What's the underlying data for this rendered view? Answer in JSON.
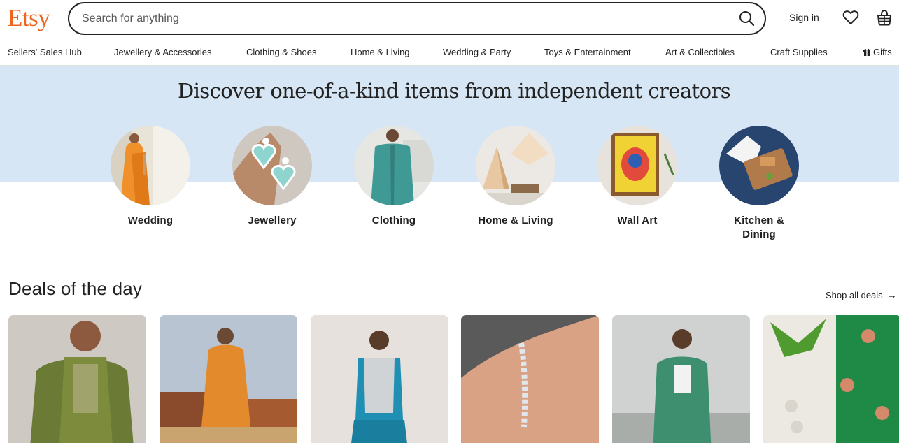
{
  "header": {
    "logo": "Etsy",
    "search_placeholder": "Search for anything",
    "sign_in": "Sign in",
    "icons": {
      "search": "search-icon",
      "favorites": "heart-icon",
      "cart": "basket-icon"
    }
  },
  "nav": {
    "items": [
      "Sellers' Sales Hub",
      "Jewellery & Accessories",
      "Clothing & Shoes",
      "Home & Living",
      "Wedding & Party",
      "Toys & Entertainment",
      "Art & Collectibles",
      "Craft Supplies",
      "Gifts"
    ],
    "gift_icon": "gift-icon"
  },
  "hero": {
    "title": "Discover one-of-a-kind items from independent creators",
    "background": "#d7e6f5",
    "categories": [
      {
        "label": "Wedding"
      },
      {
        "label": "Jewellery"
      },
      {
        "label": "Clothing"
      },
      {
        "label": "Home & Living"
      },
      {
        "label": "Wall Art"
      },
      {
        "label": "Kitchen &\nDining"
      }
    ]
  },
  "deals": {
    "title": "Deals of the day",
    "shop_all": "Shop all deals",
    "arrow": "→"
  },
  "colors": {
    "brand": "#F1641E",
    "text": "#222222"
  }
}
